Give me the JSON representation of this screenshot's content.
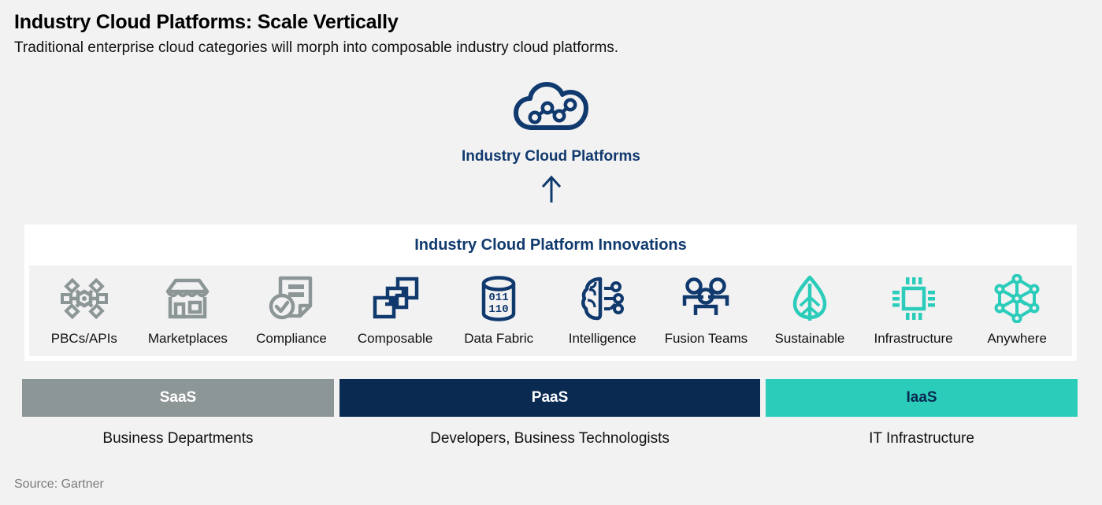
{
  "header": {
    "title": "Industry Cloud Platforms: Scale Vertically",
    "subtitle": "Traditional enterprise cloud categories will morph into composable industry cloud platforms."
  },
  "hero": {
    "icon": "cloud-network-icon",
    "label": "Industry Cloud Platforms",
    "arrow": "up-arrow-icon"
  },
  "panel": {
    "title": "Industry Cloud Platform Innovations",
    "innovations": [
      {
        "label": "PBCs/APIs",
        "icon": "packaged-business-capability-icon",
        "color": "#8D9697"
      },
      {
        "label": "Marketplaces",
        "icon": "storefront-icon",
        "color": "#8D9697"
      },
      {
        "label": "Compliance",
        "icon": "document-check-icon",
        "color": "#8D9697"
      },
      {
        "label": "Composable",
        "icon": "stacked-puzzle-panels-icon",
        "color": "#10396E"
      },
      {
        "label": "Data Fabric",
        "icon": "database-binary-icon",
        "color": "#10396E"
      },
      {
        "label": "Intelligence",
        "icon": "brain-circuit-icon",
        "color": "#10396E"
      },
      {
        "label": "Fusion Teams",
        "icon": "three-people-icon",
        "color": "#10396E"
      },
      {
        "label": "Sustainable",
        "icon": "leaf-icon",
        "color": "#2BCCBA"
      },
      {
        "label": "Infrastructure",
        "icon": "cpu-chip-icon",
        "color": "#2BCCBA"
      },
      {
        "label": "Anywhere",
        "icon": "network-mesh-icon",
        "color": "#2BCCBA"
      }
    ]
  },
  "service_layers": [
    {
      "name": "SaaS",
      "color": "#8D9697",
      "text_color": "#FFFFFF",
      "audience": "Business Departments"
    },
    {
      "name": "PaaS",
      "color": "#0A2A52",
      "text_color": "#FFFFFF",
      "audience": "Developers, Business Technologists"
    },
    {
      "name": "IaaS",
      "color": "#2BCCBA",
      "text_color": "#0A2A52",
      "audience": "IT Infrastructure"
    }
  ],
  "footer": {
    "source": "Source: Gartner"
  },
  "colors": {
    "background": "#F2F2F2",
    "navy": "#10396E",
    "navy_dark": "#0A2A52",
    "gray": "#8D9697",
    "teal": "#2BCCBA",
    "panel_white": "#FFFFFF"
  }
}
